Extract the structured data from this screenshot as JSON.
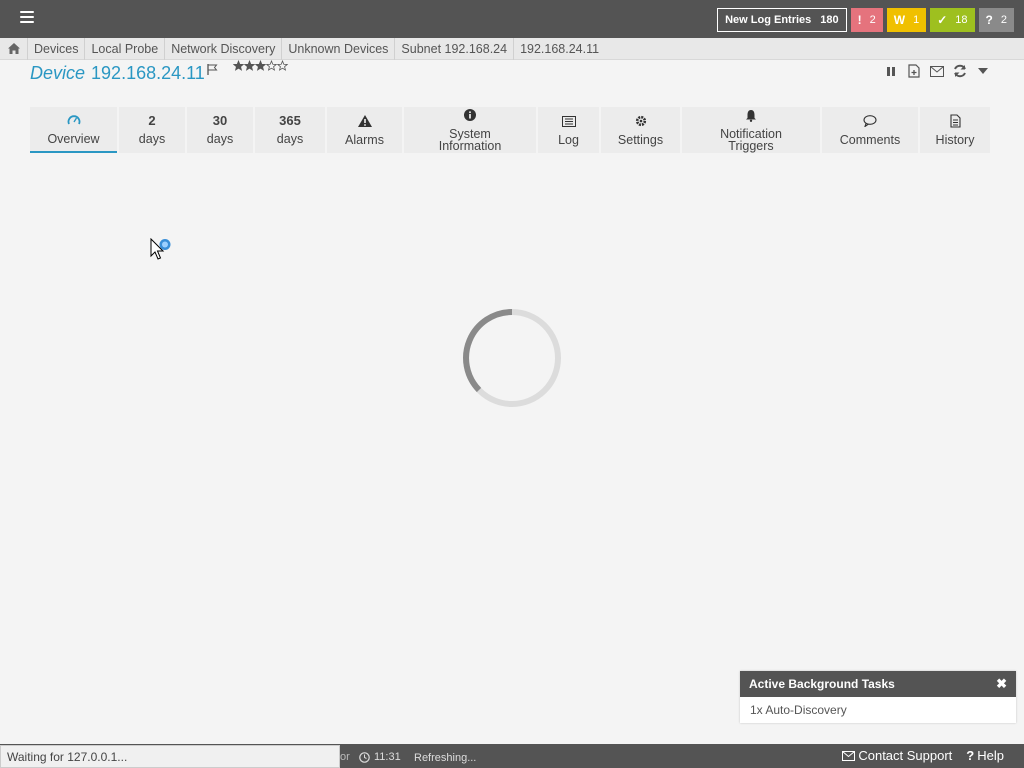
{
  "topbar": {
    "new_log_label": "New Log Entries",
    "new_log_count": "180",
    "badges": [
      {
        "symbol": "!",
        "count": "2",
        "color": "#e5737d"
      },
      {
        "symbol": "W",
        "count": "1",
        "color": "#f0c000"
      },
      {
        "symbol": "✓",
        "count": "18",
        "color": "#9ec01f"
      },
      {
        "symbol": "?",
        "count": "2",
        "color": "#8a8a8a"
      }
    ]
  },
  "breadcrumb": [
    "Devices",
    "Local Probe",
    "Network Discovery",
    "Unknown Devices",
    "Subnet 192.168.24",
    "192.168.24.11"
  ],
  "title": {
    "prefix": "Device",
    "ip": "192.168.24.11",
    "priority_stars": 3,
    "priority_max": 5
  },
  "tabs": [
    {
      "icon": "gauge-icon",
      "label": "Overview",
      "active": true
    },
    {
      "num": "2",
      "label": "days"
    },
    {
      "num": "30",
      "label": "days"
    },
    {
      "num": "365",
      "label": "days"
    },
    {
      "icon": "warning-icon",
      "label": "Alarms"
    },
    {
      "icon": "info-icon",
      "label": "System Information"
    },
    {
      "icon": "log-icon",
      "label": "Log"
    },
    {
      "icon": "gear-icon",
      "label": "Settings"
    },
    {
      "icon": "bell-icon",
      "label": "Notification Triggers"
    },
    {
      "icon": "comment-icon",
      "label": "Comments"
    },
    {
      "icon": "history-icon",
      "label": "History"
    }
  ],
  "bgtasks": {
    "title": "Active Background Tasks",
    "item": "1x Auto-Discovery"
  },
  "footer": {
    "status": "Waiting for 127.0.0.1...",
    "time": "11:31",
    "refreshing": "Refreshing...",
    "contact": "Contact Support",
    "help": "Help"
  },
  "colors": {
    "accent": "#2a97c3",
    "bar": "#545454"
  }
}
